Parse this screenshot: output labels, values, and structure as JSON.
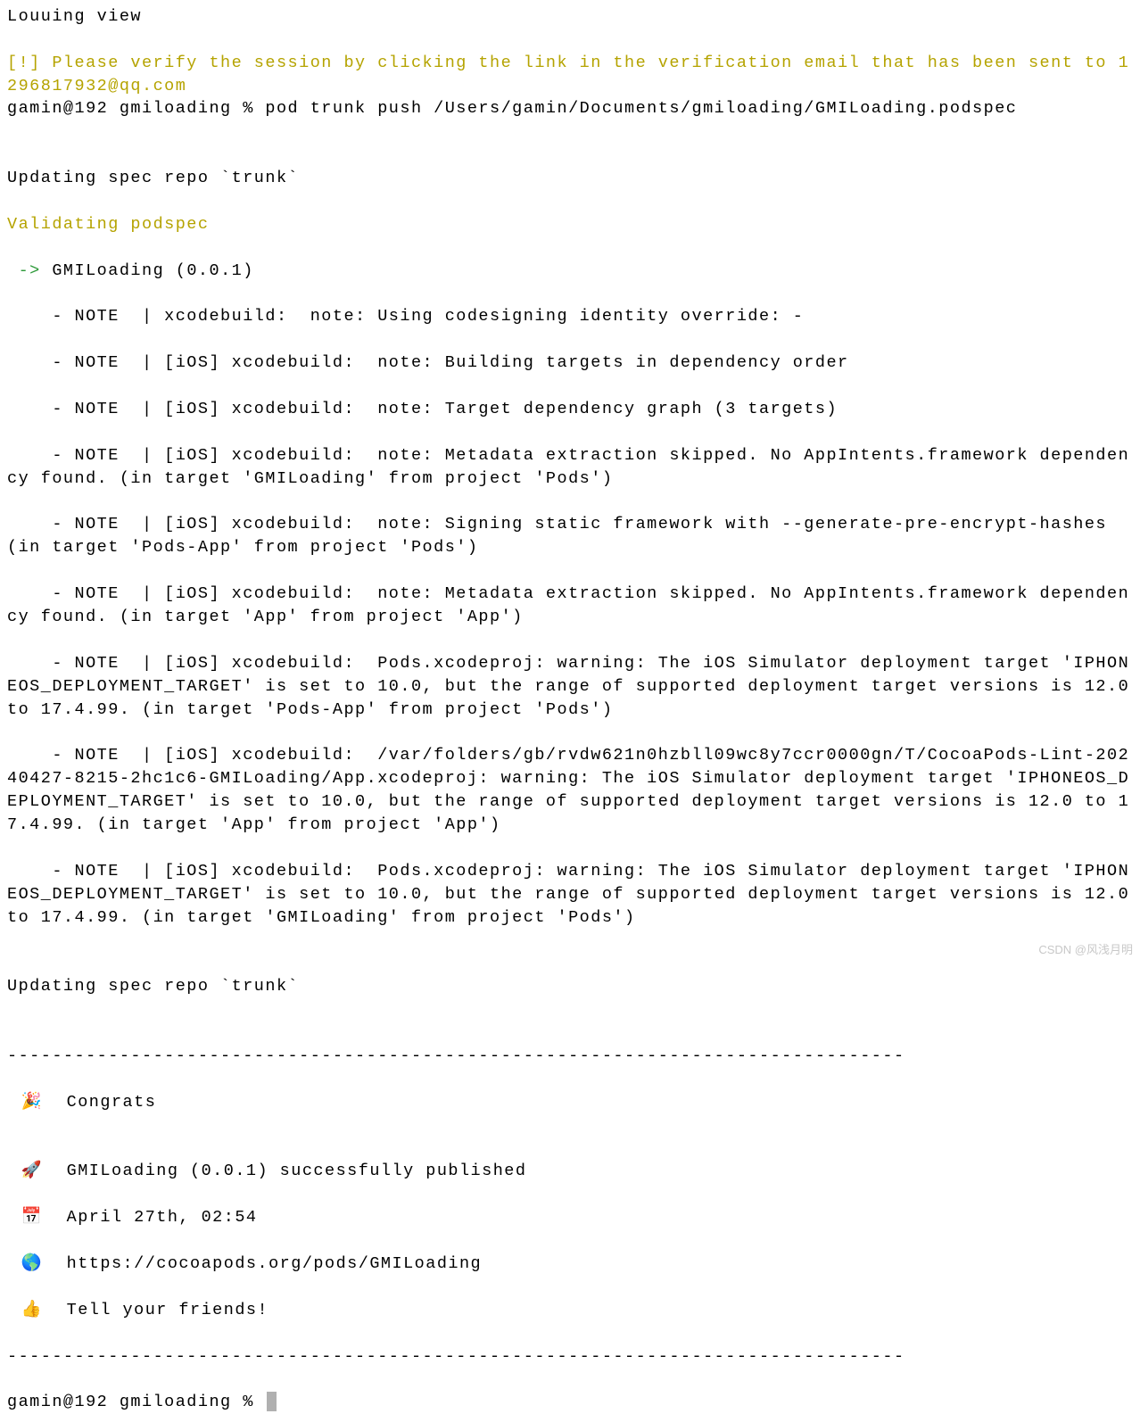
{
  "top_cut": "Louuing view",
  "warning": "[!] Please verify the session by clicking the link in the verification email that has been sent to 1296817932@qq.com",
  "prompt1": "gamin@192 gmiloading % pod trunk push /Users/gamin/Documents/gmiloading/GMILoading.podspec",
  "blank": "",
  "updating1": "Updating spec repo `trunk`",
  "validating": "Validating podspec",
  "arrow": " -> ",
  "arrow_after": "GMILoading (0.0.1)",
  "note1": "    - NOTE  | xcodebuild:  note: Using codesigning identity override: -",
  "note2": "    - NOTE  | [iOS] xcodebuild:  note: Building targets in dependency order",
  "note3": "    - NOTE  | [iOS] xcodebuild:  note: Target dependency graph (3 targets)",
  "note4": "    - NOTE  | [iOS] xcodebuild:  note: Metadata extraction skipped. No AppIntents.framework dependency found. (in target 'GMILoading' from project 'Pods')",
  "note5": "    - NOTE  | [iOS] xcodebuild:  note: Signing static framework with --generate-pre-encrypt-hashes (in target 'Pods-App' from project 'Pods')",
  "note6": "    - NOTE  | [iOS] xcodebuild:  note: Metadata extraction skipped. No AppIntents.framework dependency found. (in target 'App' from project 'App')",
  "note7": "    - NOTE  | [iOS] xcodebuild:  Pods.xcodeproj: warning: The iOS Simulator deployment target 'IPHONEOS_DEPLOYMENT_TARGET' is set to 10.0, but the range of supported deployment target versions is 12.0 to 17.4.99. (in target 'Pods-App' from project 'Pods')",
  "note8": "    - NOTE  | [iOS] xcodebuild:  /var/folders/gb/rvdw621n0hzbll09wc8y7ccr0000gn/T/CocoaPods-Lint-20240427-8215-2hc1c6-GMILoading/App.xcodeproj: warning: The iOS Simulator deployment target 'IPHONEOS_DEPLOYMENT_TARGET' is set to 10.0, but the range of supported deployment target versions is 12.0 to 17.4.99. (in target 'App' from project 'App')",
  "note9": "    - NOTE  | [iOS] xcodebuild:  Pods.xcodeproj: warning: The iOS Simulator deployment target 'IPHONEOS_DEPLOYMENT_TARGET' is set to 10.0, but the range of supported deployment target versions is 12.0 to 17.4.99. (in target 'GMILoading' from project 'Pods')",
  "updating2": "Updating spec repo `trunk`",
  "divider": "--------------------------------------------------------------------------------",
  "congrats": {
    "emoji": "🎉",
    "text": "  Congrats"
  },
  "published": {
    "emoji": "🚀",
    "text": "  GMILoading (0.0.1) successfully published"
  },
  "date": {
    "emoji": "📅",
    "text": "  April 27th, 02:54"
  },
  "url": {
    "emoji": "🌎",
    "text": "  https://cocoapods.org/pods/GMILoading"
  },
  "tell": {
    "emoji": "👍",
    "text": "  Tell your friends!"
  },
  "prompt2": "gamin@192 gmiloading % ",
  "watermark": "CSDN @风浅月明"
}
